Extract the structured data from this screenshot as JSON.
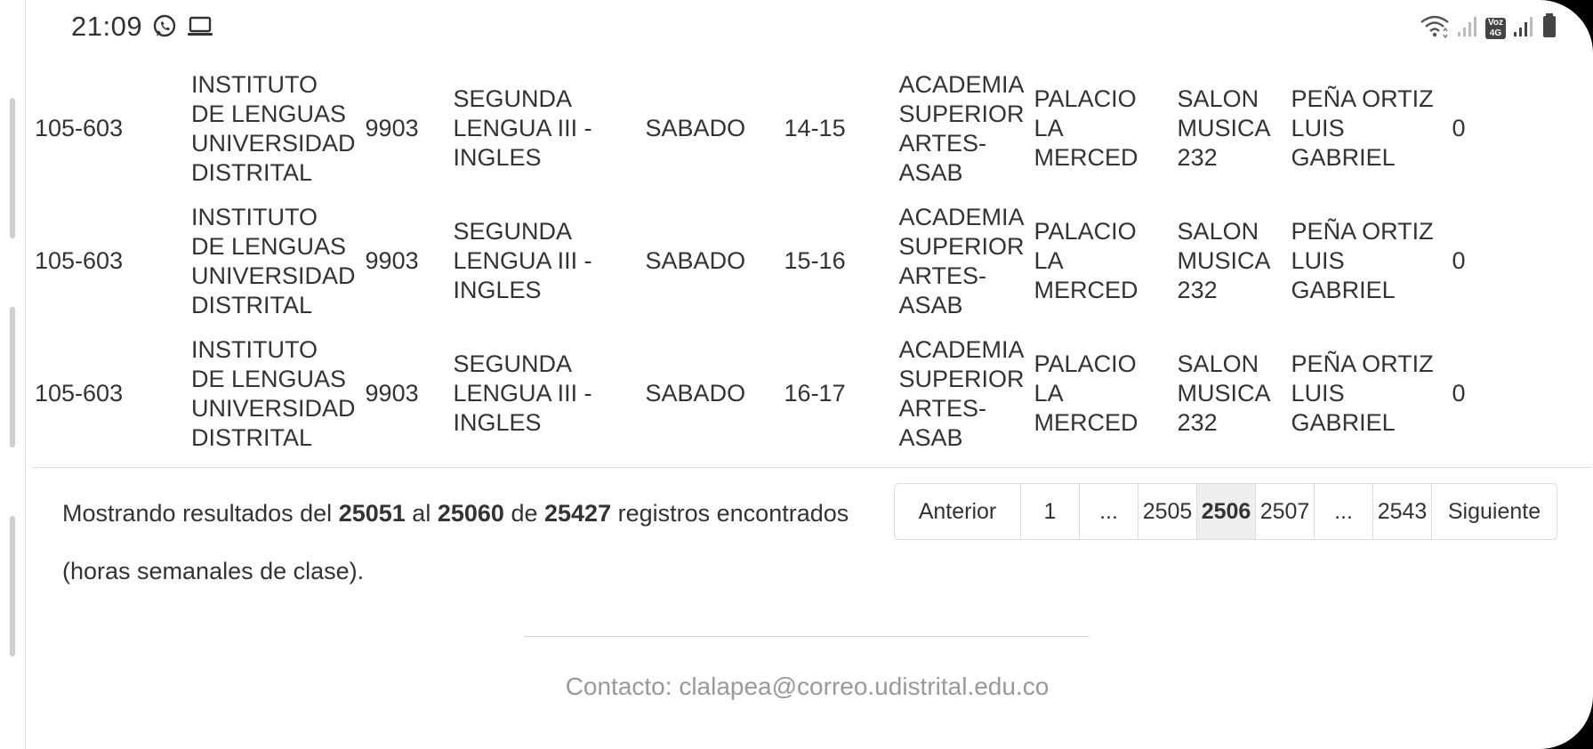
{
  "status_bar": {
    "time": "21:09",
    "left_icons": [
      "whatsapp-icon",
      "laptop-icon"
    ],
    "right_icons": [
      "wifi-icon",
      "signal-icon",
      "volte-icon",
      "signal-icon",
      "battery-icon"
    ],
    "volte_label": "Voz",
    "network_label": "4G"
  },
  "rows": [
    {
      "code": "105-603",
      "institute": "INSTITUTO DE LENGUAS UNIVERSIDAD DISTRITAL",
      "number": "9903",
      "subject": "SEGUNDA LENGUA III - INGLES",
      "day": "SABADO",
      "hours": "14-15",
      "campus": "ACADEMIA SUPERIOR ARTES-ASAB",
      "building": "PALACIO LA MERCED",
      "room": "SALON MUSICA 232",
      "teacher": "PEÑA ORTIZ LUIS GABRIEL",
      "count": "0"
    },
    {
      "code": "105-603",
      "institute": "INSTITUTO DE LENGUAS UNIVERSIDAD DISTRITAL",
      "number": "9903",
      "subject": "SEGUNDA LENGUA III - INGLES",
      "day": "SABADO",
      "hours": "15-16",
      "campus": "ACADEMIA SUPERIOR ARTES-ASAB",
      "building": "PALACIO LA MERCED",
      "room": "SALON MUSICA 232",
      "teacher": "PEÑA ORTIZ LUIS GABRIEL",
      "count": "0"
    },
    {
      "code": "105-603",
      "institute": "INSTITUTO DE LENGUAS UNIVERSIDAD DISTRITAL",
      "number": "9903",
      "subject": "SEGUNDA LENGUA III - INGLES",
      "day": "SABADO",
      "hours": "16-17",
      "campus": "ACADEMIA SUPERIOR ARTES-ASAB",
      "building": "PALACIO LA MERCED",
      "room": "SALON MUSICA 232",
      "teacher": "PEÑA ORTIZ LUIS GABRIEL",
      "count": "0"
    }
  ],
  "summary": {
    "prefix": "Mostrando resultados del",
    "from": "25051",
    "al": "al",
    "to": "25060",
    "de": "de",
    "total": "25427",
    "suffix": "registros encontrados (horas semanales de clase)."
  },
  "pagination": {
    "prev": "Anterior",
    "pages": [
      "1",
      "...",
      "2505",
      "2506",
      "2507",
      "...",
      "2543"
    ],
    "active": "2506",
    "next": "Siguiente"
  },
  "footer": {
    "contact": "Contacto: clalapea@correo.udistrital.edu.co"
  },
  "colors": {
    "text": "#333333",
    "muted": "#999999",
    "active_page_bg": "#eeeeee",
    "border": "#dddddd"
  }
}
